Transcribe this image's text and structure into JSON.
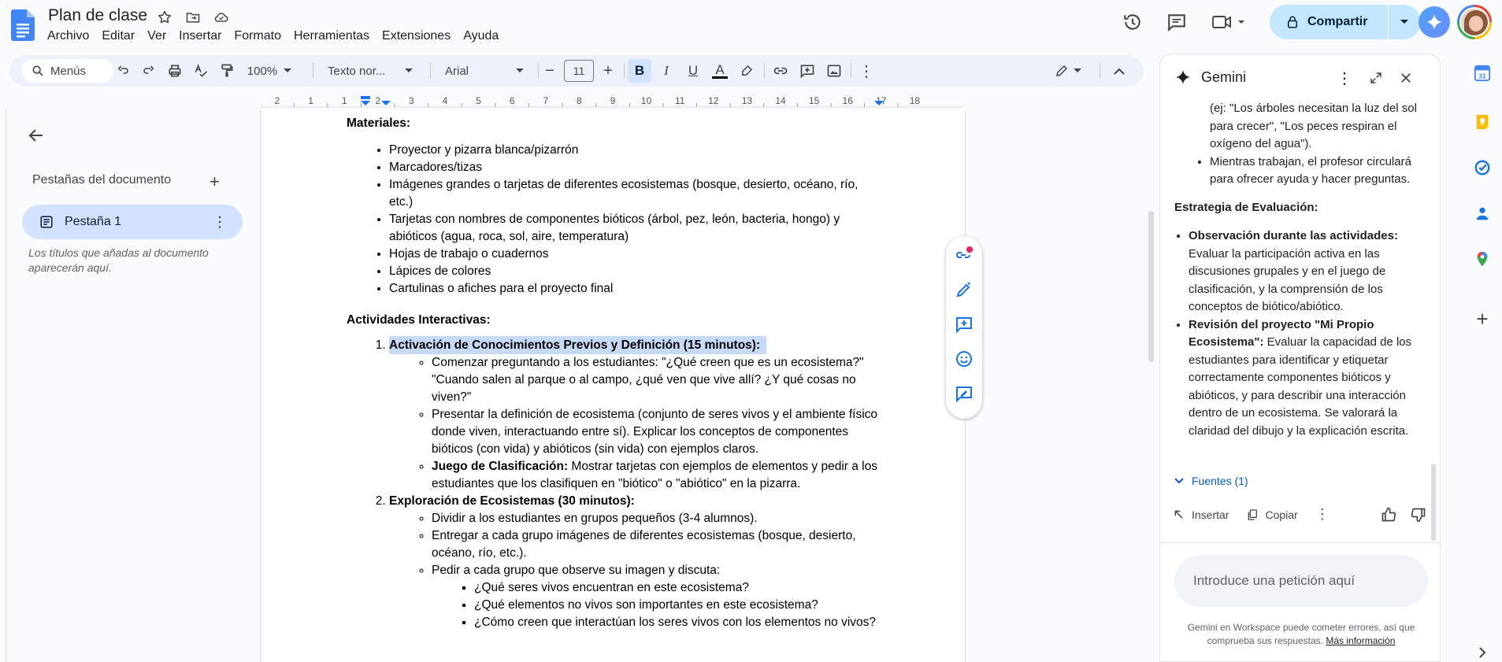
{
  "doc": {
    "title": "Plan de clase"
  },
  "menu": [
    "Archivo",
    "Editar",
    "Ver",
    "Insertar",
    "Formato",
    "Herramientas",
    "Extensiones",
    "Ayuda"
  ],
  "share": {
    "label": "Compartir"
  },
  "toolbar": {
    "search_label": "Menús",
    "zoom": "100%",
    "style": "Texto nor...",
    "font": "Arial",
    "font_size": "11"
  },
  "ruler": {
    "ticks": [
      "2",
      "1",
      "1",
      "2",
      "3",
      "4",
      "5",
      "6",
      "7",
      "8",
      "9",
      "10",
      "11",
      "12",
      "13",
      "14",
      "15",
      "16",
      "17",
      "18"
    ]
  },
  "sidebar": {
    "heading": "Pestañas del documento",
    "tab_label": "Pestaña 1",
    "note": "Los títulos que añadas al documento aparecerán aquí."
  },
  "document": {
    "materials_heading": "Materiales:",
    "materials": [
      "Proyector y pizarra blanca/pizarrón",
      "Marcadores/tizas",
      "Imágenes grandes o tarjetas de diferentes ecosistemas (bosque, desierto, océano, río, etc.)",
      "Tarjetas con nombres de componentes bióticos (árbol, pez, león, bacteria, hongo) y abióticos (agua, roca, sol, aire, temperatura)",
      "Hojas de trabajo o cuadernos",
      "Lápices de colores",
      "Cartulinas o afiches para el proyecto final"
    ],
    "activities_heading": "Actividades Interactivas:",
    "activity1": {
      "title": "Activación de Conocimientos Previos y Definición (15 minutos):",
      "items": [
        "Comenzar preguntando a los estudiantes: \"¿Qué creen que es un ecosistema?\" \"Cuando salen al parque o al campo, ¿qué ven que vive allí? ¿Y qué cosas no viven?\"",
        "Presentar la definición de ecosistema (conjunto de seres vivos y el ambiente físico donde viven, interactuando entre sí). Explicar los conceptos de componentes bióticos (con vida) y abióticos (sin vida) con ejemplos claros."
      ],
      "game_bold": "Juego de Clasificación:",
      "game_text": " Mostrar tarjetas con ejemplos de elementos y pedir a los estudiantes que los clasifiquen en \"biótico\" o \"abiótico\" en la pizarra."
    },
    "activity2": {
      "title": "Exploración de Ecosistemas (30 minutos):",
      "items": [
        "Dividir a los estudiantes en grupos pequeños (3-4 alumnos).",
        "Entregar a cada grupo imágenes de diferentes ecosistemas (bosque, desierto, océano, río, etc.).",
        "Pedir a cada grupo que observe su imagen y discuta:"
      ],
      "questions": [
        "¿Qué seres vivos encuentran en este ecosistema?",
        "¿Qué elementos no vivos son importantes en este ecosistema?",
        "¿Cómo creen que interactúan los seres vivos con los elementos no vivos?"
      ]
    }
  },
  "gemini": {
    "title": "Gemini",
    "partial_item": "(ej: \"Los árboles necesitan la luz del sol para crecer\", \"Los peces respiran el oxígeno del agua\").",
    "item2": "Mientras trabajan, el profesor circulará para ofrecer ayuda y hacer preguntas.",
    "eval_heading": "Estrategia de Evaluación:",
    "eval1_bold": "Observación durante las actividades:",
    "eval1_text": " Evaluar la participación activa en las discusiones grupales y en el juego de clasificación, y la comprensión de los conceptos de biótico/abiótico.",
    "eval2_bold": "Revisión del proyecto \"Mi Propio Ecosistema\":",
    "eval2_text": " Evaluar la capacidad de los estudiantes para identificar y etiquetar correctamente componentes bióticos y abióticos, y para describir una interacción dentro de un ecosistema. Se valorará la claridad del dibujo y la explicación escrita.",
    "sources": "Fuentes (1)",
    "insert": "Insertar",
    "copy": "Copiar",
    "input_placeholder": "Introduce una petición aquí",
    "disclaimer": "Gemini en Workspace puede cometer errores, así que comprueba sus respuestas.",
    "more_info": "Más información"
  },
  "colors": {
    "accent": "#0b57d0",
    "share_bg": "#c2e7ff",
    "tab_bg": "#d3e3fd",
    "highlight": "#c6d9f5"
  }
}
